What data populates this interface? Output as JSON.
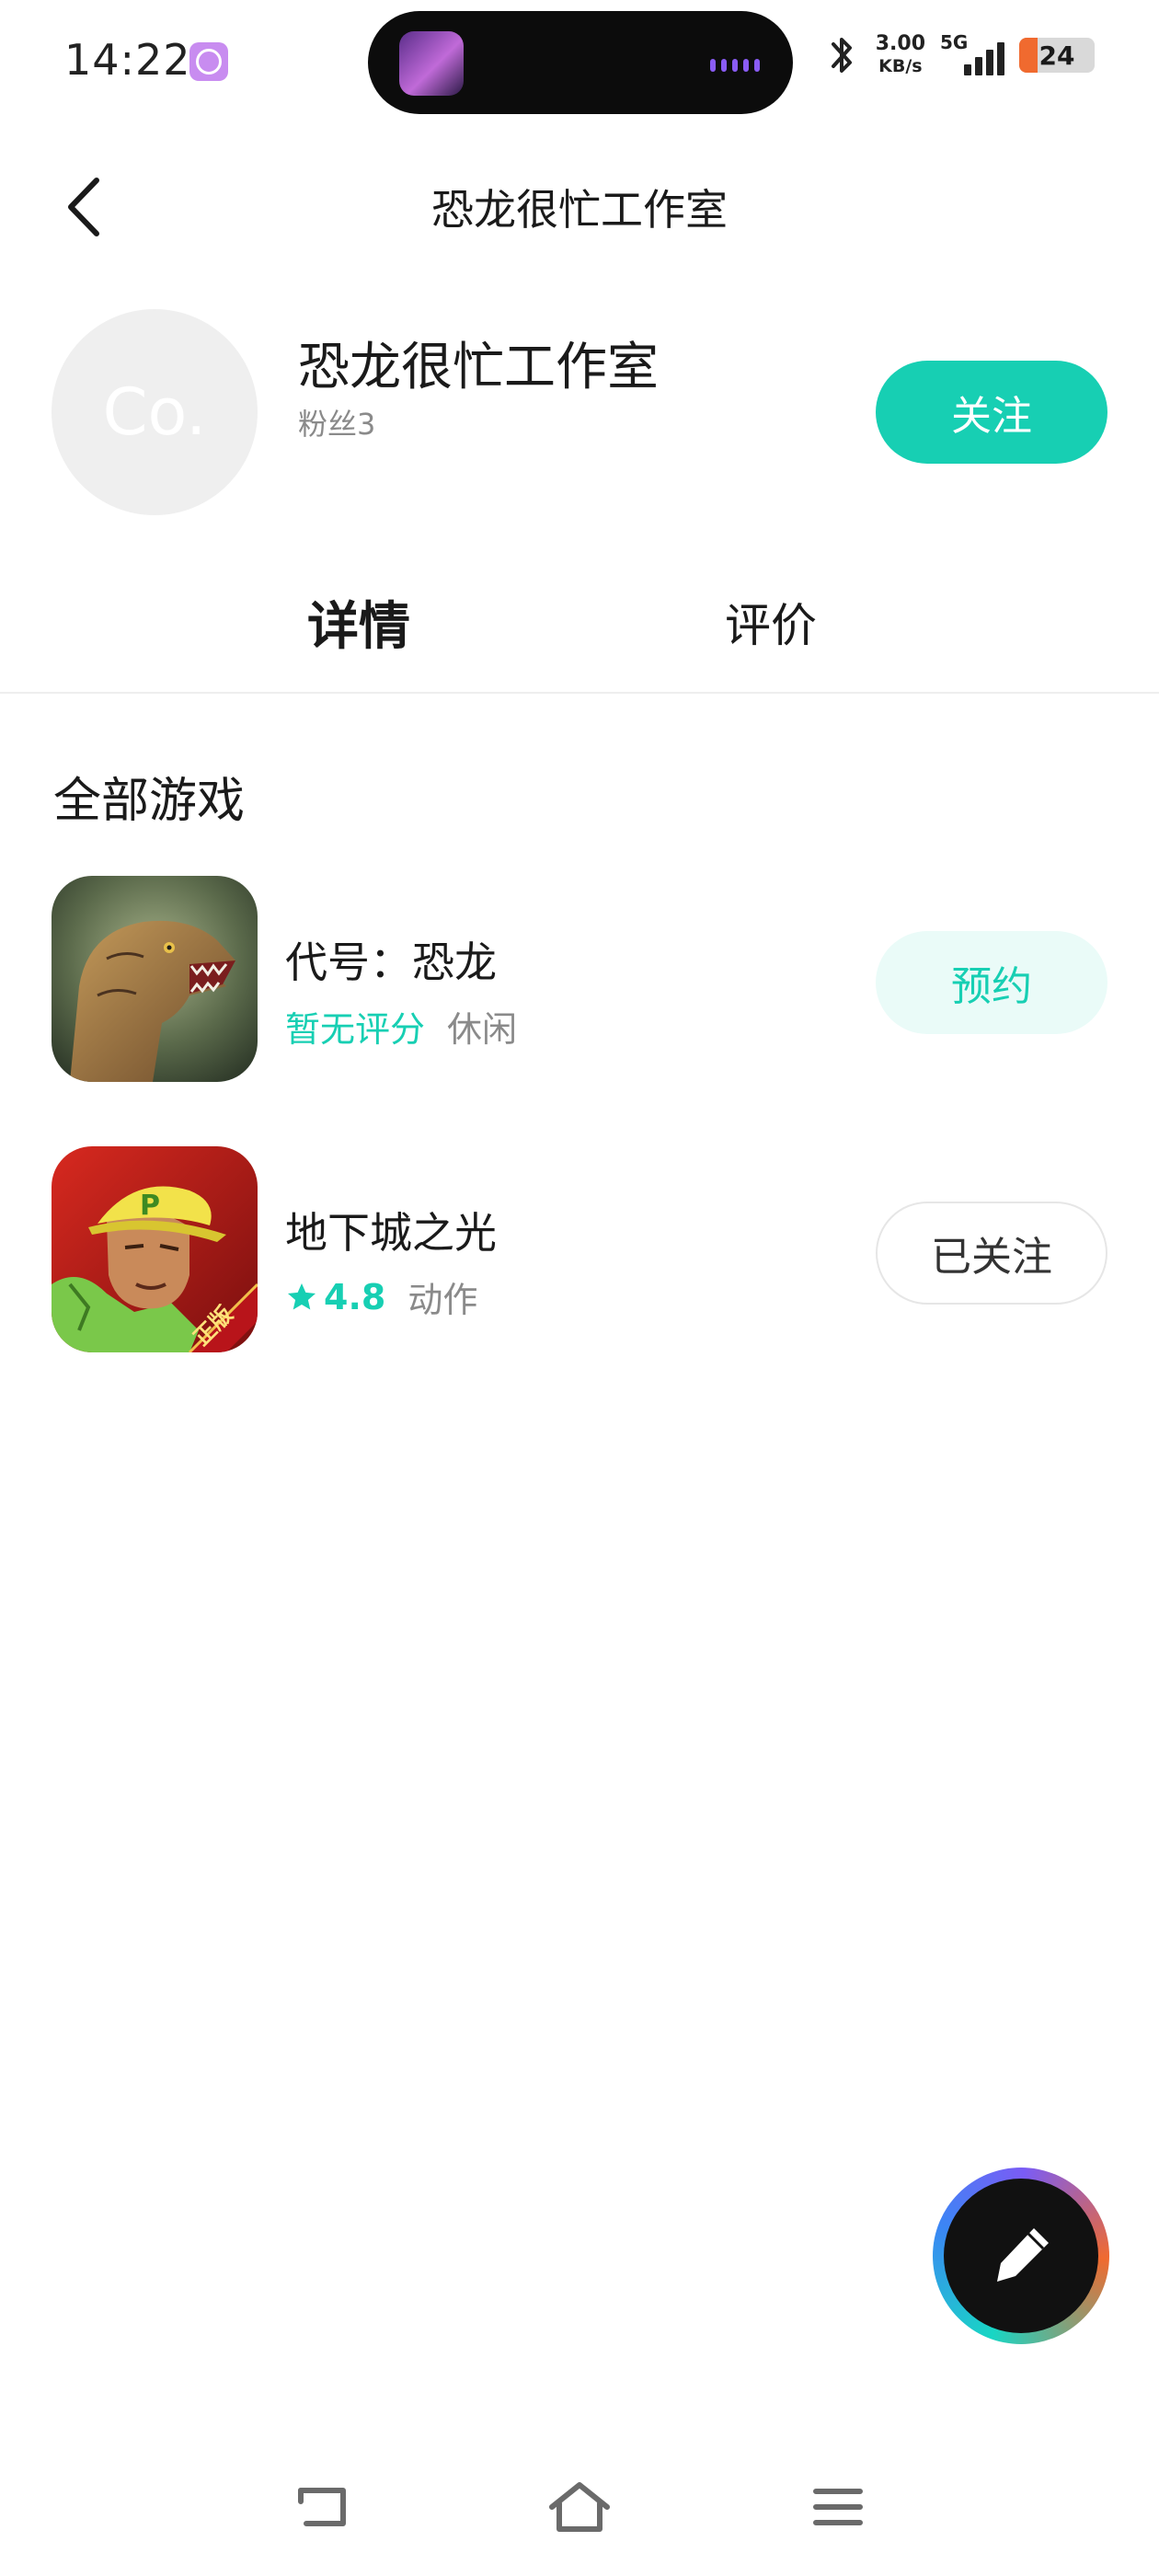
{
  "status_bar": {
    "time": "14:22",
    "net_speed_value": "3.00",
    "net_speed_unit": "KB/s",
    "network": "5G",
    "battery": "24",
    "battery_level": 0.24,
    "icons": [
      "app-notification-icon",
      "bluetooth-icon",
      "signal-icon",
      "battery-icon"
    ]
  },
  "header": {
    "title": "恐龙很忙工作室",
    "back_icon": "chevron-left-icon"
  },
  "studio": {
    "avatar_text": "Co.",
    "name": "恐龙很忙工作室",
    "fans": "粉丝3",
    "follow_label": "关注"
  },
  "tabs": [
    {
      "label": "详情",
      "active": true
    },
    {
      "label": "评价",
      "active": false
    }
  ],
  "games_section": {
    "title": "全部游戏",
    "games": [
      {
        "name": "代号：恐龙",
        "rating": "暂无评分",
        "genre": "休闲",
        "action_label": "预约",
        "icon": "dinosaur-game-icon"
      },
      {
        "name": "地下城之光",
        "rating": "4.8",
        "genre": "动作",
        "action_label": "已关注",
        "icon": "dungeon-game-icon",
        "icon_badge": "正版"
      }
    ]
  },
  "fab": {
    "icon": "pencil-icon"
  },
  "nav_bar": {
    "icons": [
      "back-nav-icon",
      "home-nav-icon",
      "menu-nav-icon"
    ]
  },
  "colors": {
    "accent": "#17cfb3",
    "accent_light": "#eafbf8",
    "text_primary": "#1a1a1a",
    "text_secondary": "#8a8a8a"
  }
}
